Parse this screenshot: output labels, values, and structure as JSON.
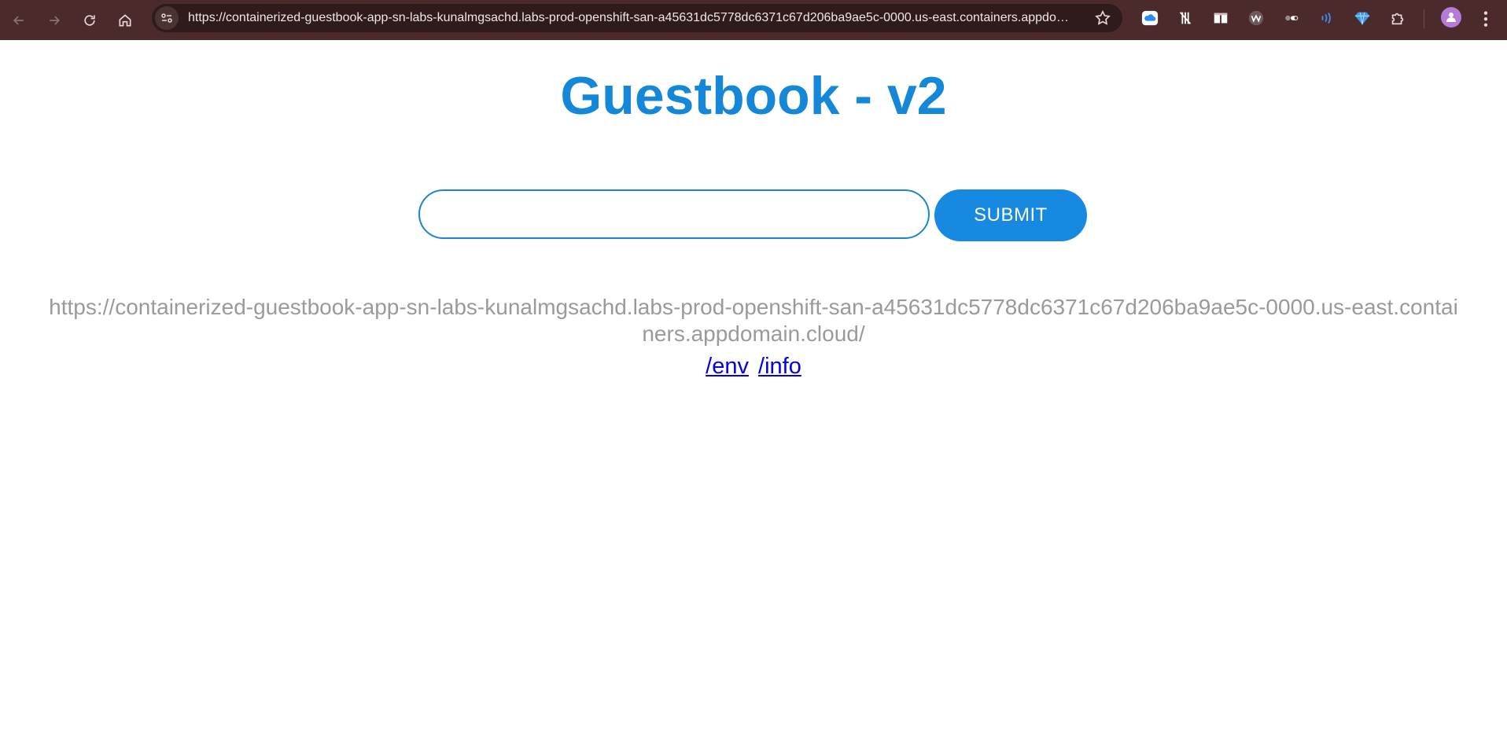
{
  "browser": {
    "url": "https://containerized-guestbook-app-sn-labs-kunalmgsachd.labs-prod-openshift-san-a45631dc5778dc6371c67d206ba9ae5c-0000.us-east.containers.appdomain.cloud/",
    "nav_icons": [
      "back-arrow-icon",
      "forward-arrow-icon",
      "reload-icon",
      "home-icon"
    ],
    "extension_icons": [
      "cloud-icon",
      "tracker-blocker-icon",
      "reader-icon",
      "wave-icon",
      "toggle-icon",
      "audio-icon",
      "gem-icon",
      "puzzle-icon"
    ]
  },
  "page": {
    "title": "Guestbook - v2",
    "form": {
      "input_value": "",
      "input_placeholder": "",
      "submit_label": "SUBMIT"
    },
    "host_url": "https://containerized-guestbook-app-sn-labs-kunalmgsachd.labs-prod-openshift-san-a45631dc5778dc6371c67d206ba9ae5c-0000.us-east.containers.appdomain.cloud/",
    "links": [
      {
        "label": "/env"
      },
      {
        "label": "/info"
      }
    ]
  },
  "colors": {
    "accent": "#1487d8",
    "chrome_bg": "#4a2a2b",
    "muted_text": "#9a9a9a",
    "link": "#0000ee"
  }
}
